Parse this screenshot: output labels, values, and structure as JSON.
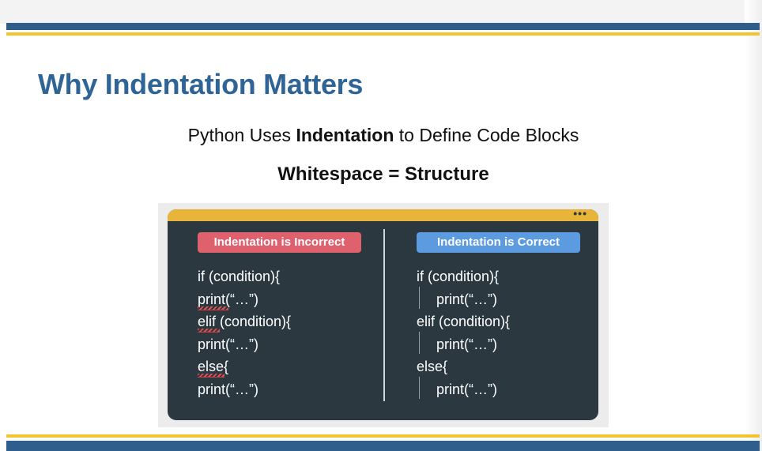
{
  "slide": {
    "title": "Why Indentation Matters",
    "subtitle_pre": "Python Uses ",
    "subtitle_bold": "Indentation",
    "subtitle_post": " to Define Code Blocks",
    "tagline": "Whitespace = Structure"
  },
  "figure": {
    "window_dots": "•••",
    "incorrect": {
      "label": "Indentation is Incorrect",
      "color": "#e0616e",
      "lines": [
        "if (condition){",
        "print(“…”)",
        "elif (condition){",
        "print(“…”)",
        "else{",
        "print(“…”)"
      ]
    },
    "correct": {
      "label": "Indentation is Correct",
      "color": "#5c9be0",
      "lines": [
        "if (condition){",
        "print(“…”)",
        "elif (condition){",
        "print(“…”)",
        "else{",
        "print(“…”)"
      ]
    }
  },
  "colors": {
    "title": "#2f6496",
    "bar_blue": "#2f5d8c",
    "bar_yellow": "#f2c530",
    "code_background": "#2b3840",
    "window_bar": "#e8b43a"
  }
}
